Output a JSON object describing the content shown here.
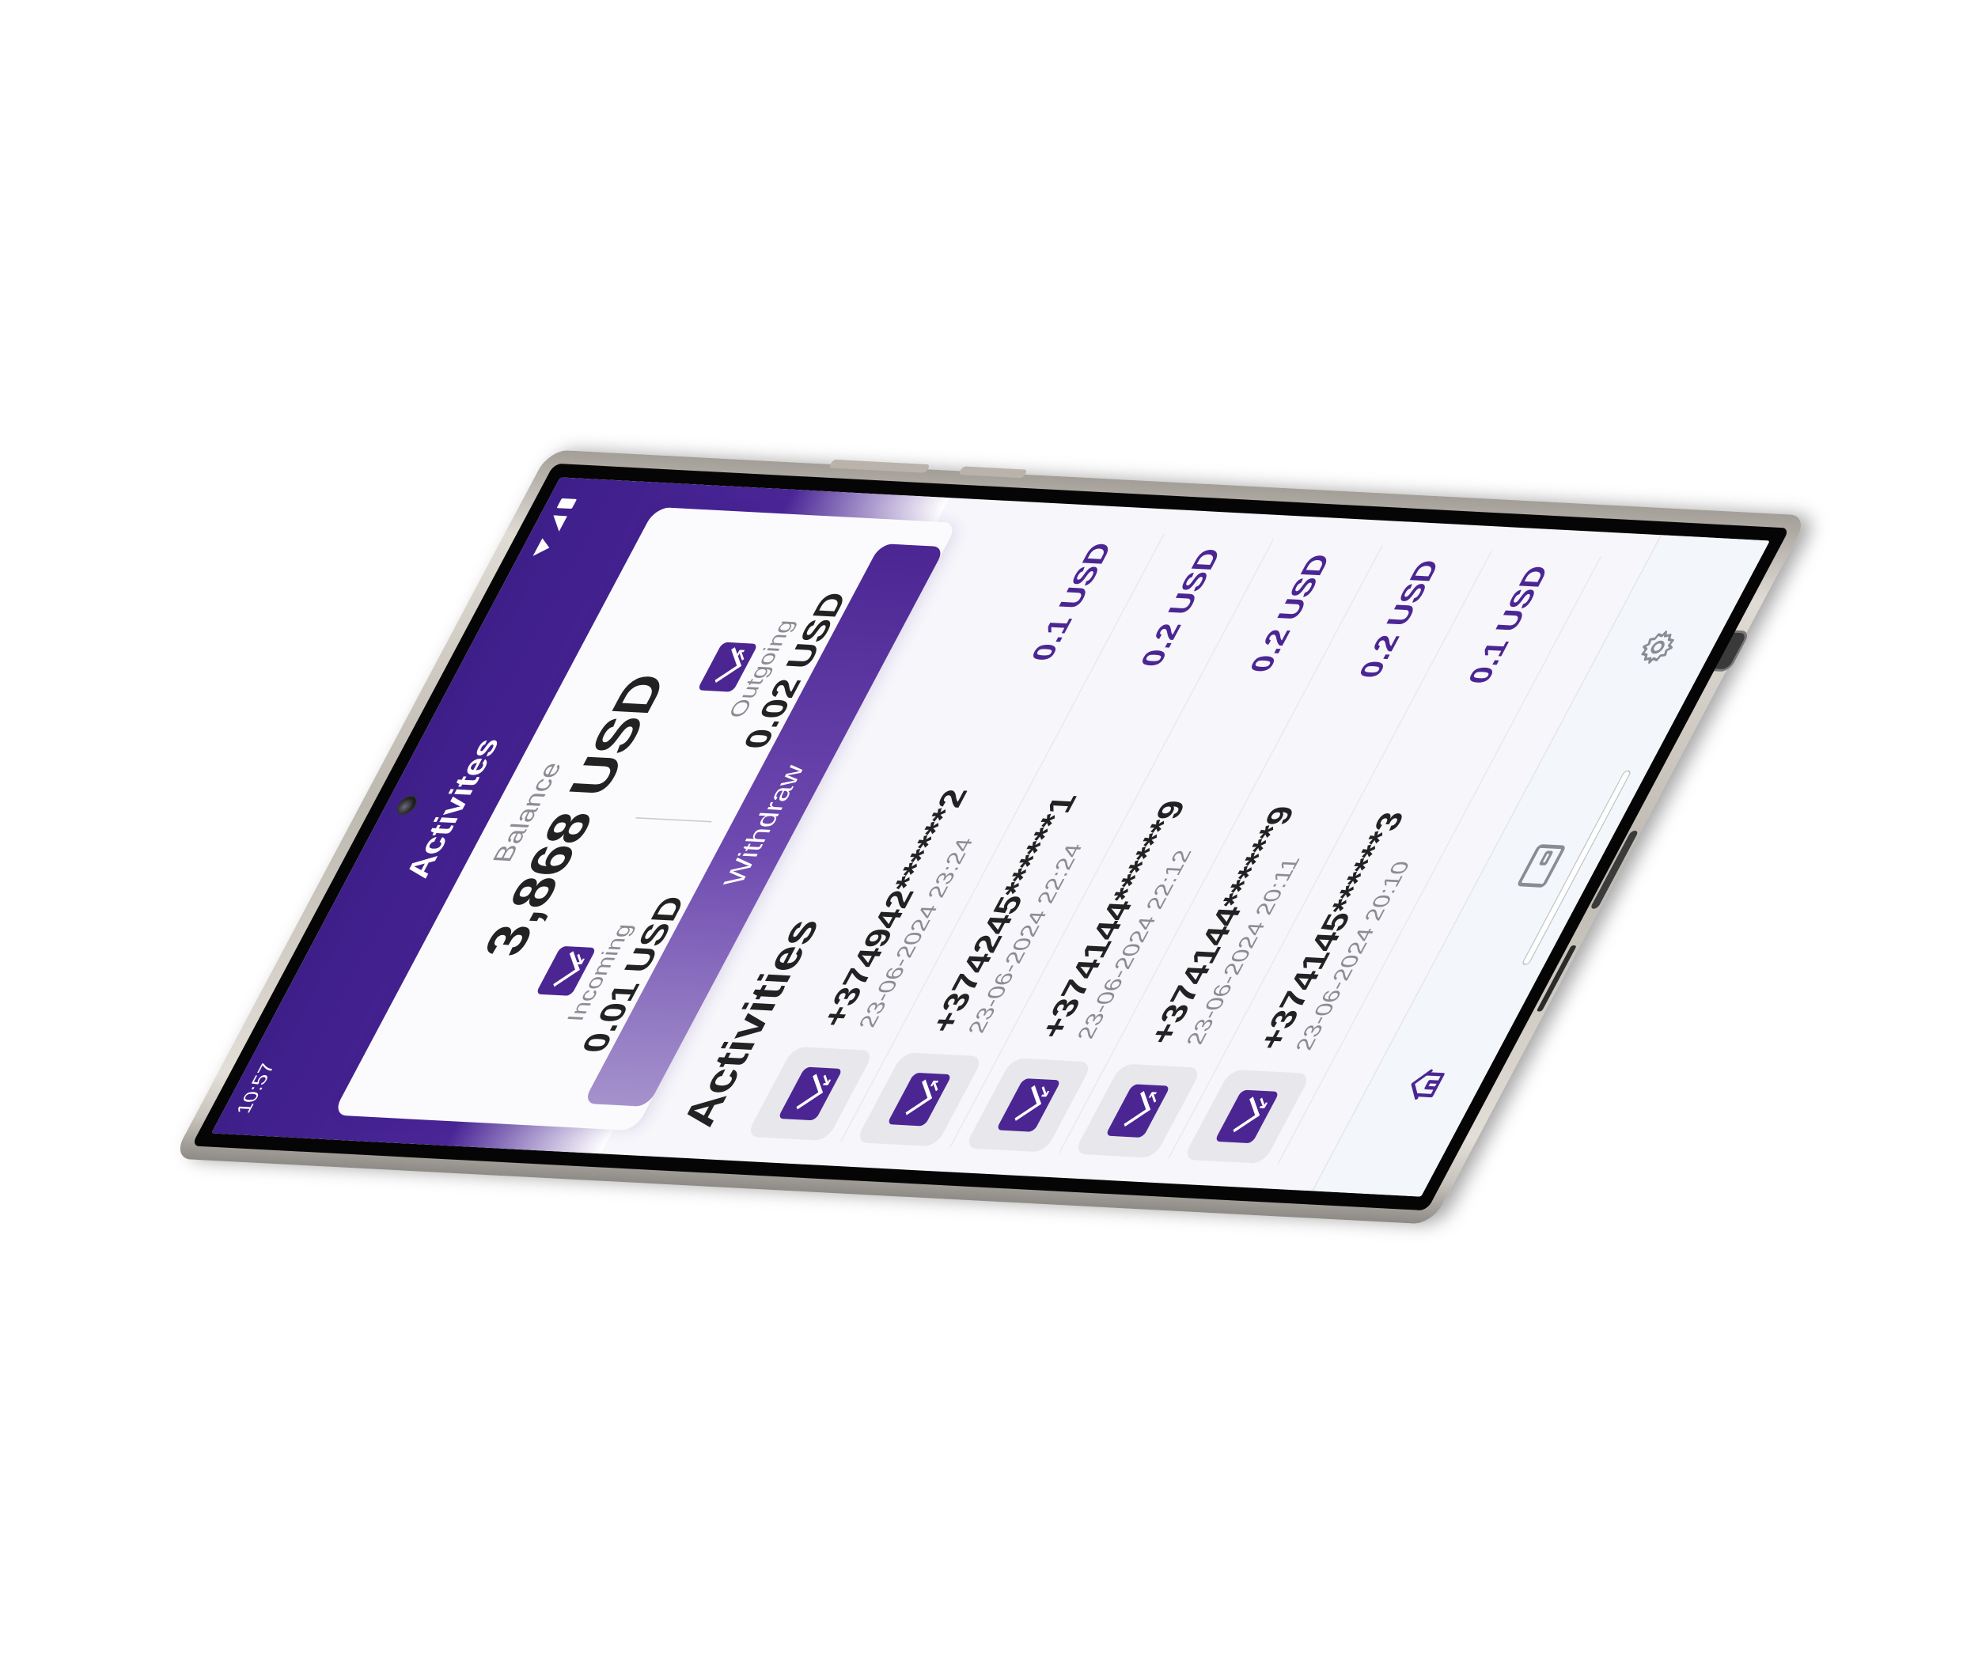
{
  "status_bar": {
    "time": "10:57"
  },
  "header": {
    "title": "Activites"
  },
  "balance": {
    "label": "Balance",
    "value": "3,868 USD"
  },
  "incoming": {
    "label": "Incoming",
    "value": "0.01 USD",
    "icon": "envelope-incoming-icon"
  },
  "outgoing": {
    "label": "Outgoing",
    "value": "0.02 USD",
    "icon": "envelope-outgoing-icon"
  },
  "withdraw_button": {
    "label": "Withdraw"
  },
  "activities": {
    "title": "Activities",
    "items": [
      {
        "phone": "+374942******2",
        "date": "23-06-2024  23:24",
        "amount": "0.1 USD",
        "direction": "incoming"
      },
      {
        "phone": "+374245******1",
        "date": "23-06-2024  22:24",
        "amount": "0.2 USD",
        "direction": "outgoing"
      },
      {
        "phone": "+374144******9",
        "date": "23-06-2024  22:12",
        "amount": "0.2 USD",
        "direction": "incoming"
      },
      {
        "phone": "+374144******9",
        "date": "23-06-2024  20:11",
        "amount": "0.2 USD",
        "direction": "outgoing"
      },
      {
        "phone": "+374145******3",
        "date": "23-06-2024  20:10",
        "amount": "0.1 USD",
        "direction": "incoming"
      }
    ]
  },
  "bottom_nav": {
    "items": [
      {
        "icon": "home-icon"
      },
      {
        "icon": "wallet-icon"
      },
      {
        "icon": "gear-icon"
      }
    ]
  },
  "colors": {
    "brand": "#4b2693",
    "header_gradient_top": "#3e1f8a",
    "withdraw_gradient_start": "#a592cc",
    "withdraw_gradient_end": "#4b2693",
    "amount_text": "#4b2693",
    "phone_frame": "#c9c4bd"
  }
}
